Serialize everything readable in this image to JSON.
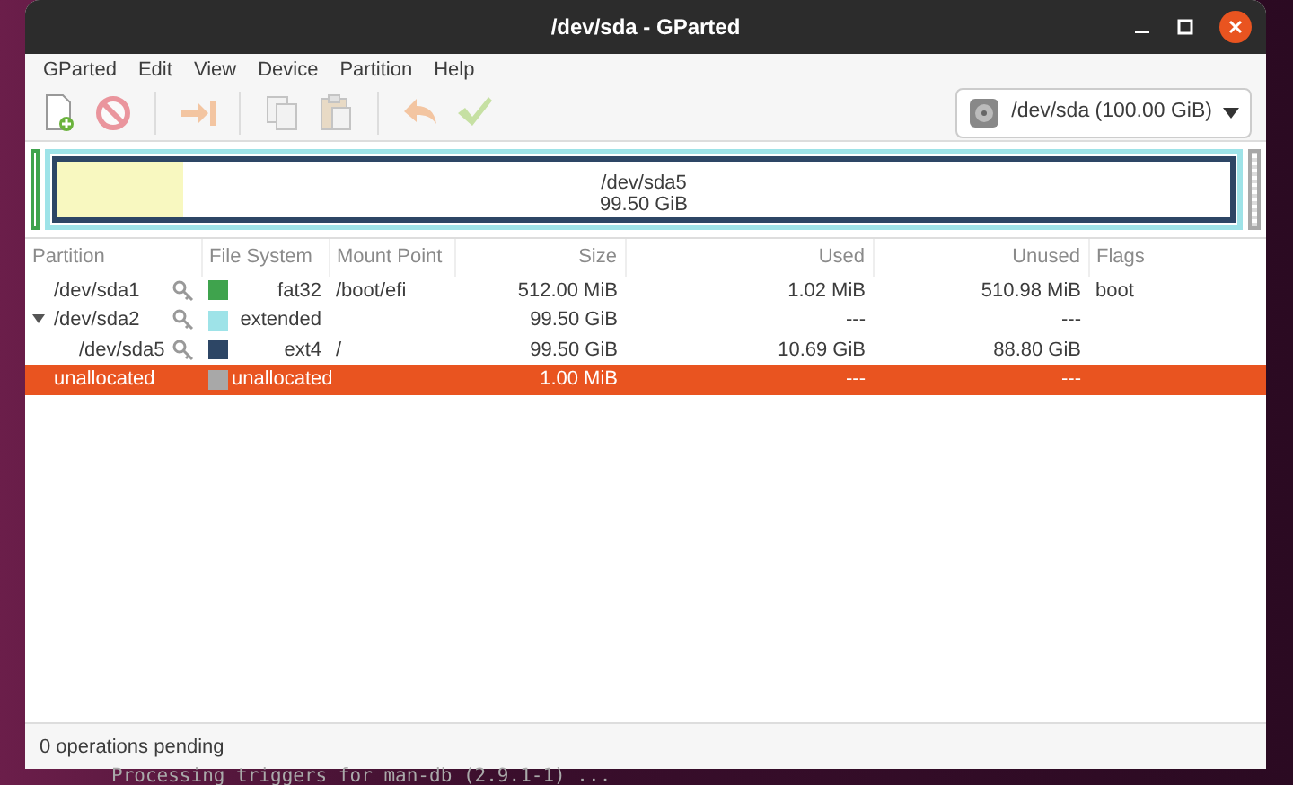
{
  "window": {
    "title": "/dev/sda - GParted"
  },
  "menu": [
    "GParted",
    "Edit",
    "View",
    "Device",
    "Partition",
    "Help"
  ],
  "toolbar": [
    {
      "kind": "new",
      "disabled": false
    },
    {
      "kind": "delete",
      "disabled": true
    },
    {
      "kind": "sep"
    },
    {
      "kind": "resize",
      "disabled": true
    },
    {
      "kind": "sep"
    },
    {
      "kind": "copy",
      "disabled": true
    },
    {
      "kind": "paste",
      "disabled": true
    },
    {
      "kind": "sep"
    },
    {
      "kind": "undo",
      "disabled": true
    },
    {
      "kind": "apply",
      "disabled": true
    }
  ],
  "device": {
    "label": "/dev/sda (100.00 GiB)"
  },
  "graph": {
    "label": "/dev/sda5",
    "size": "99.50 GiB",
    "level": 0.107
  },
  "table": {
    "columns": [
      "Partition",
      "File System",
      "Mount Point",
      "Size",
      "Used",
      "Unused",
      "Flags"
    ],
    "rows": [
      {
        "partition": "/dev/sda1",
        "busy": true,
        "color": "#3fa34d",
        "fs": "fat32",
        "mount": "/boot/efi",
        "size": "512.00 MiB",
        "used": "1.02 MiB",
        "unused": "510.98 MiB",
        "flags": "boot",
        "selected": false
      },
      {
        "partition": "/dev/sda2",
        "busy": true,
        "expanded": true,
        "color": "#9ee3e8",
        "fs": "extended",
        "size": "99.50 GiB",
        "used": "---",
        "unused": "---",
        "selected": false,
        "children": [
          {
            "partition": "/dev/sda5",
            "busy": true,
            "color": "#2d4665",
            "fs": "ext4",
            "mount": "/",
            "size": "99.50 GiB",
            "used": "10.69 GiB",
            "unused": "88.80 GiB",
            "selected": false
          }
        ]
      },
      {
        "partition": "unallocated",
        "busy": false,
        "color": "#a8a8a8",
        "fs": "unallocated",
        "size": "1.00 MiB",
        "used": "---",
        "unused": "---",
        "selected": true
      }
    ]
  },
  "status_bar": "0 operations pending",
  "terminal": "Processing triggers for man-db (2.9.1-1) ..."
}
